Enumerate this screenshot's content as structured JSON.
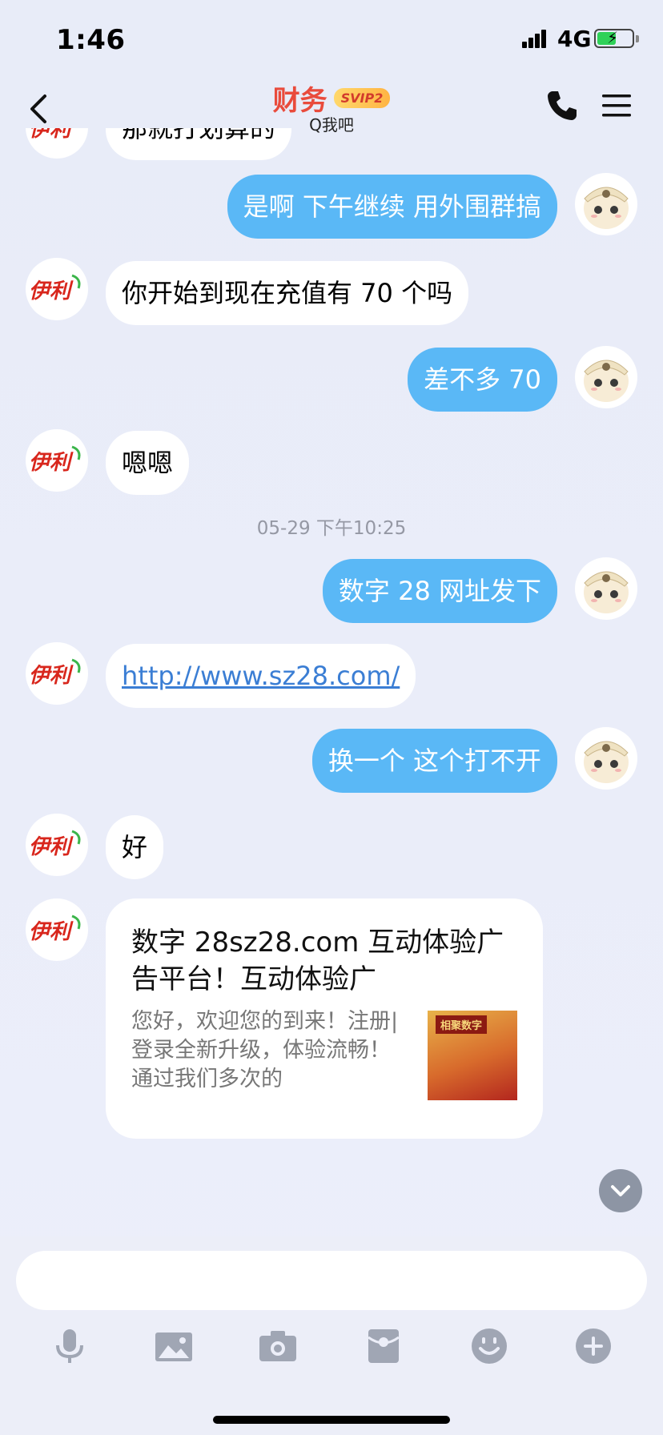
{
  "status_bar": {
    "time": "1:46",
    "network": "4G",
    "battery_level": 0.55
  },
  "header": {
    "title": "财务",
    "badge": "SVIP2",
    "subtitle": "Q我吧"
  },
  "partner_avatar_text": "伊利",
  "messages": [
    {
      "side": "in",
      "text": "那就打划算的"
    },
    {
      "side": "out",
      "text": "是啊 下午继续 用外围群搞"
    },
    {
      "side": "in",
      "text": "你开始到现在充值有 70 个吗"
    },
    {
      "side": "out",
      "text": "差不多 70"
    },
    {
      "side": "in",
      "text": "嗯嗯"
    },
    {
      "side": "time",
      "text": "05-29 下午10:25"
    },
    {
      "side": "out",
      "text": "数字 28 网址发下"
    },
    {
      "side": "in",
      "text": "http://www.sz28.com/",
      "link": true
    },
    {
      "side": "out",
      "text": "换一个 这个打不开"
    },
    {
      "side": "in",
      "text": "好"
    }
  ],
  "link_card": {
    "title": "数字 28sz28.com 互动体验广告平台！互动体验广",
    "description": "您好，欢迎您的到来！注册|登录全新升级，体验流畅！通过我们多次的",
    "thumb_label": "相聚数字"
  },
  "input": {
    "placeholder": ""
  },
  "toolbar": [
    "microphone-icon",
    "image-icon",
    "camera-icon",
    "red-packet-icon",
    "emoji-icon",
    "plus-icon"
  ],
  "colors": {
    "out_bubble": "#5AB8F6",
    "title": "#E94B3C",
    "link": "#3B7ED4"
  }
}
